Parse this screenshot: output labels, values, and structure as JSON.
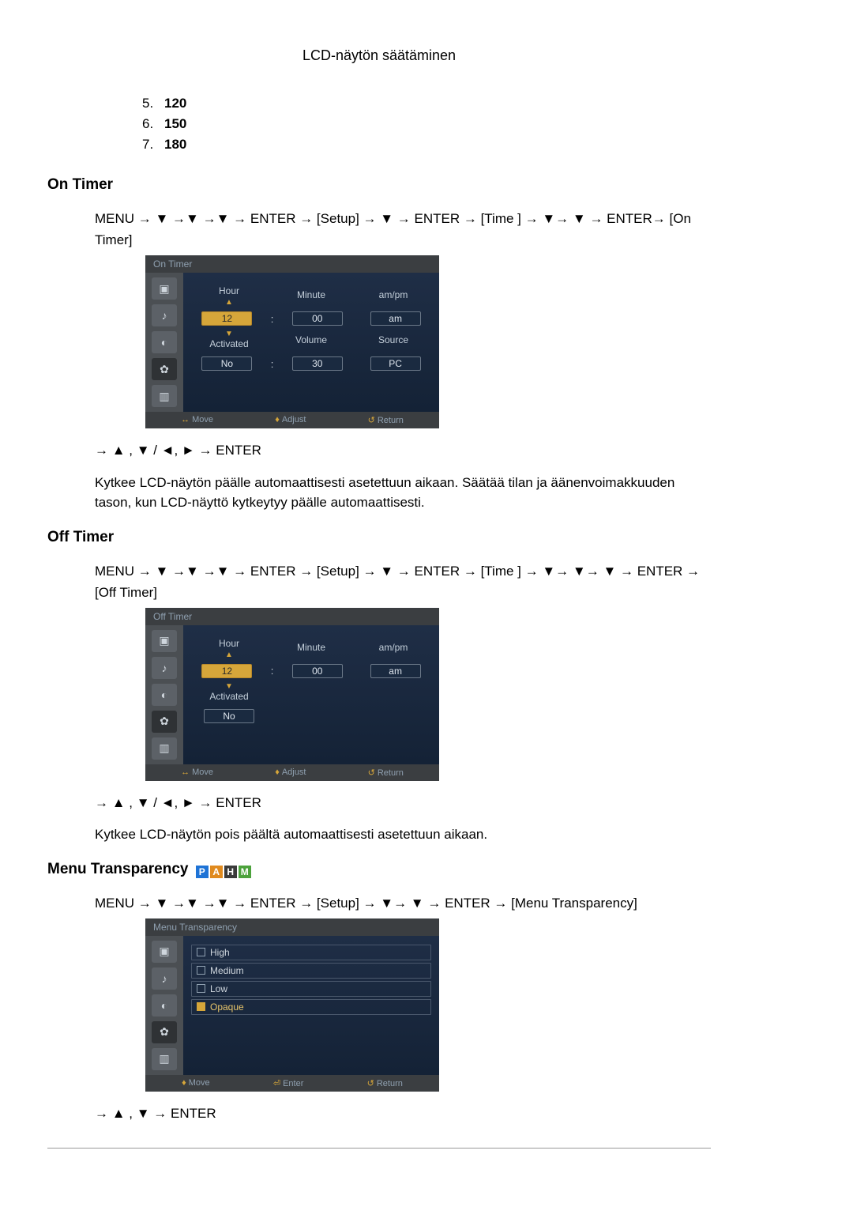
{
  "page_header": "LCD-näytön säätäminen",
  "list": {
    "i5": {
      "n": "5.",
      "v": "120"
    },
    "i6": {
      "n": "6.",
      "v": "150"
    },
    "i7": {
      "n": "7.",
      "v": "180"
    }
  },
  "arrows": {
    "down": "▼",
    "up": "▲",
    "left": "◄",
    "right": "►",
    "to": "→"
  },
  "labels": {
    "enter": "ENTER",
    "menu": "MENU",
    "setup": "Setup",
    "time": "Time",
    "ontimer": "On Timer",
    "offtimer": "Off Timer",
    "menutrans": "Menu Transparency"
  },
  "on_timer": {
    "heading": "On Timer",
    "nav": "MENU → ▼ →▼ →▼ → ENTER → [Setup] → ▼ → ENTER → [Time ] → ▼→ ▼ → ENTER→ [On Timer]",
    "post_nav": "→ ▲ , ▼ / ◄, ► → ENTER",
    "desc": "Kytkee LCD-näytön päälle automaattisesti asetettuun aikaan. Säätää tilan ja äänenvoimakkuuden tason, kun LCD-näyttö kytkeytyy päälle automaattisesti.",
    "osd": {
      "title": "On Timer",
      "cols": {
        "hour": "Hour",
        "minute": "Minute",
        "ampm": "am/pm",
        "activated": "Activated",
        "volume": "Volume",
        "source": "Source"
      },
      "vals": {
        "hour": "12",
        "minute": "00",
        "ampm": "am",
        "activated": "No",
        "volume": "30",
        "source": "PC"
      },
      "foot": {
        "move": "Move",
        "adjust": "Adjust",
        "return": "Return"
      }
    }
  },
  "off_timer": {
    "heading": "Off Timer",
    "nav": "MENU → ▼ →▼ →▼ → ENTER → [Setup] → ▼ → ENTER → [Time ] → ▼→ ▼→ ▼ → ENTER → [Off Timer]",
    "post_nav": "→ ▲ , ▼ / ◄, ► → ENTER",
    "desc": "Kytkee LCD-näytön pois päältä automaattisesti asetettuun aikaan.",
    "osd": {
      "title": "Off Timer",
      "cols": {
        "hour": "Hour",
        "minute": "Minute",
        "ampm": "am/pm",
        "activated": "Activated"
      },
      "vals": {
        "hour": "12",
        "minute": "00",
        "ampm": "am",
        "activated": "No"
      },
      "foot": {
        "move": "Move",
        "adjust": "Adjust",
        "return": "Return"
      }
    }
  },
  "menu_trans": {
    "heading": "Menu Transparency",
    "tags": [
      "P",
      "A",
      "H",
      "M"
    ],
    "nav": "MENU → ▼ →▼ →▼ → ENTER → [Setup] → ▼→ ▼ → ENTER → [Menu Transparency]",
    "post_nav": "→ ▲ , ▼ → ENTER",
    "osd": {
      "title": "Menu Transparency",
      "items": [
        {
          "label": "High",
          "selected": false
        },
        {
          "label": "Medium",
          "selected": false
        },
        {
          "label": "Low",
          "selected": false
        },
        {
          "label": "Opaque",
          "selected": true
        }
      ],
      "foot": {
        "move": "Move",
        "enter": "Enter",
        "return": "Return"
      }
    }
  }
}
